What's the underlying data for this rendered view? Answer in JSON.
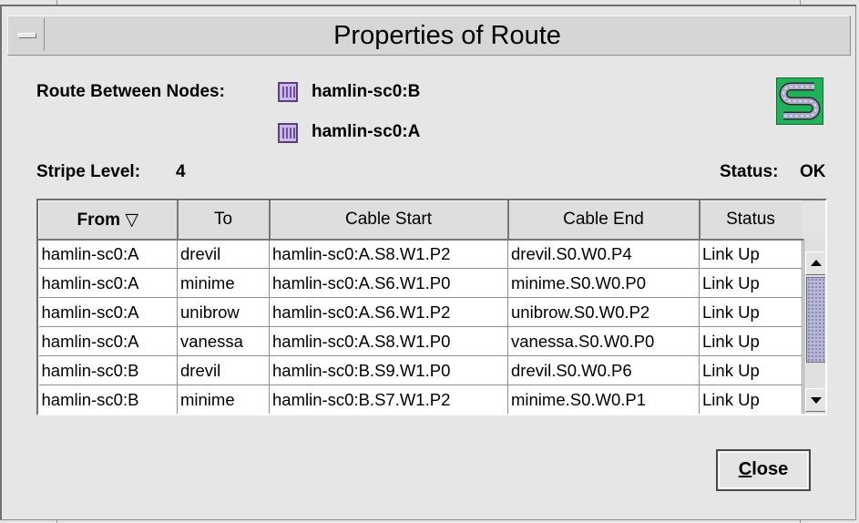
{
  "window": {
    "title": "Properties of Route"
  },
  "route": {
    "between_label": "Route Between Nodes:",
    "node_1": "hamlin-sc0:B",
    "node_2": "hamlin-sc0:A"
  },
  "stripe": {
    "label": "Stripe Level:",
    "value": "4"
  },
  "status": {
    "label": "Status:",
    "value": "OK"
  },
  "table": {
    "columns": [
      "From",
      "To",
      "Cable Start",
      "Cable End",
      "Status"
    ],
    "sort_indicator": "▽",
    "rows": [
      [
        "hamlin-sc0:A",
        "drevil",
        "hamlin-sc0:A.S8.W1.P2",
        "drevil.S0.W0.P4",
        "Link Up"
      ],
      [
        "hamlin-sc0:A",
        "minime",
        "hamlin-sc0:A.S6.W1.P0",
        "minime.S0.W0.P0",
        "Link Up"
      ],
      [
        "hamlin-sc0:A",
        "unibrow",
        "hamlin-sc0:A.S6.W1.P2",
        "unibrow.S0.W0.P2",
        "Link Up"
      ],
      [
        "hamlin-sc0:A",
        "vanessa",
        "hamlin-sc0:A.S8.W1.P0",
        "vanessa.S0.W0.P0",
        "Link Up"
      ],
      [
        "hamlin-sc0:B",
        "drevil",
        "hamlin-sc0:B.S9.W1.P0",
        "drevil.S0.W0.P6",
        "Link Up"
      ],
      [
        "hamlin-sc0:B",
        "minime",
        "hamlin-sc0:B.S7.W1.P2",
        "minime.S0.W0.P1",
        "Link Up"
      ]
    ]
  },
  "buttons": {
    "close_label_mnemonic": "C",
    "close_label_rest": "lose"
  },
  "icons": {
    "menu": "window-menu-icon",
    "node": "node-icon",
    "route": "route-icon",
    "sort": "sort-descending-icon"
  },
  "colors": {
    "node_icon": "#c9b9e8",
    "route_icon_bg": "#22b05a",
    "scroll_thumb": "#b7b7d6"
  }
}
